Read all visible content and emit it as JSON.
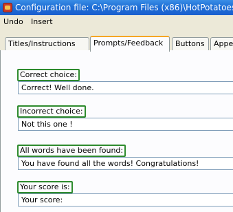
{
  "window": {
    "title": "Configuration file: C:\\Program Files (x86)\\HotPotatoes"
  },
  "menubar": {
    "items": [
      {
        "label": "Undo"
      },
      {
        "label": "Insert"
      }
    ]
  },
  "tabs": [
    {
      "label": "Titles/Instructions",
      "active": false
    },
    {
      "label": "Prompts/Feedback",
      "active": true
    },
    {
      "label": "Buttons",
      "active": false
    },
    {
      "label": "Appe",
      "active": false
    }
  ],
  "fields": [
    {
      "label": "Correct choice:",
      "value": "Correct! Well done."
    },
    {
      "label": "Incorrect choice:",
      "value": "Not this one !"
    },
    {
      "label": "All words have been found:",
      "value": "You have found all the words! Congratulations!"
    },
    {
      "label": "Your score is:",
      "value": "Your score:"
    }
  ],
  "colors": {
    "titlebar": "#1f6fd6",
    "highlight_border": "#2e8b2e",
    "active_tab_accent": "#f5a623"
  }
}
